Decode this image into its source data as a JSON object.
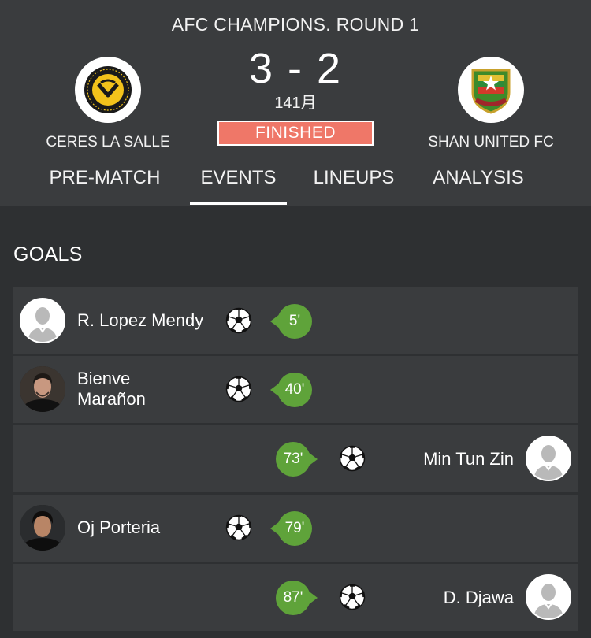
{
  "match": {
    "competition": "AFC CHAMPIONS. ROUND 1",
    "score": "3 - 2",
    "date": "141月",
    "status": "FINISHED",
    "home_team": {
      "name": "CERES LA SALLE",
      "crest_icon": "ceres-la-salle-crest",
      "crest_text": "CERES · NEGROS · FOOTBALL CLUB"
    },
    "away_team": {
      "name": "SHAN UNITED FC",
      "crest_icon": "shan-united-crest"
    }
  },
  "tabs": [
    {
      "label": "PRE-MATCH",
      "active": false
    },
    {
      "label": "EVENTS",
      "active": true
    },
    {
      "label": "LINEUPS",
      "active": false
    },
    {
      "label": "ANALYSIS",
      "active": false
    }
  ],
  "goals_section": {
    "title": "GOALS",
    "events": [
      {
        "player": "R. Lopez Mendy",
        "minute": "5'",
        "side": "home",
        "avatar": "placeholder-avatar-icon",
        "event_icon": "soccer-ball-icon"
      },
      {
        "player": "Bienve Marañon",
        "minute": "40'",
        "side": "home",
        "avatar": "player-photo",
        "event_icon": "soccer-ball-icon"
      },
      {
        "player": "Min Tun Zin",
        "minute": "73'",
        "side": "away",
        "avatar": "placeholder-avatar-icon",
        "event_icon": "soccer-ball-icon"
      },
      {
        "player": "Oj Porteria",
        "minute": "79'",
        "side": "home",
        "avatar": "player-photo",
        "event_icon": "soccer-ball-icon"
      },
      {
        "player": "D. Djawa",
        "minute": "87'",
        "side": "away",
        "avatar": "placeholder-avatar-icon",
        "event_icon": "soccer-ball-icon"
      }
    ]
  },
  "colors": {
    "background": "#2e3032",
    "panel": "#3a3c3e",
    "status_badge": "#ef7768",
    "minute_bubble": "#5fa33a"
  }
}
